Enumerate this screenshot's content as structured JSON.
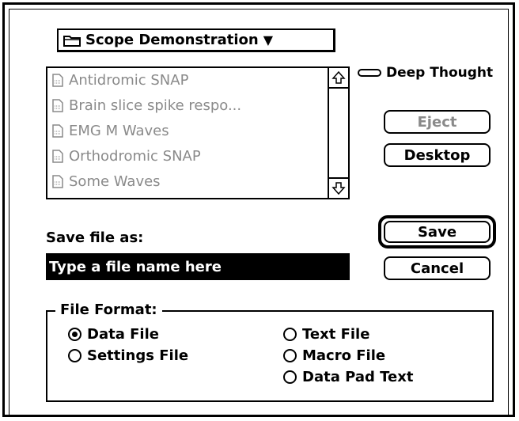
{
  "folder_popup": {
    "label": "Scope Demonstration",
    "arrow": "▼"
  },
  "volume": {
    "name": "Deep Thought"
  },
  "file_list": {
    "items": [
      {
        "name": "Antidromic SNAP"
      },
      {
        "name": "Brain slice spike respo..."
      },
      {
        "name": "EMG M Waves"
      },
      {
        "name": "Orthodromic SNAP"
      },
      {
        "name": "Some Waves"
      }
    ]
  },
  "buttons": {
    "eject": "Eject",
    "desktop": "Desktop",
    "save": "Save",
    "cancel": "Cancel"
  },
  "save_as": {
    "label": "Save file as:",
    "value": "Type a file name here"
  },
  "file_format": {
    "title": "File Format:",
    "options": [
      {
        "label": "Data File",
        "selected": true
      },
      {
        "label": "Settings File",
        "selected": false
      },
      {
        "label": "Text File",
        "selected": false
      },
      {
        "label": "Macro File",
        "selected": false
      },
      {
        "label": "Data Pad Text",
        "selected": false
      }
    ]
  }
}
